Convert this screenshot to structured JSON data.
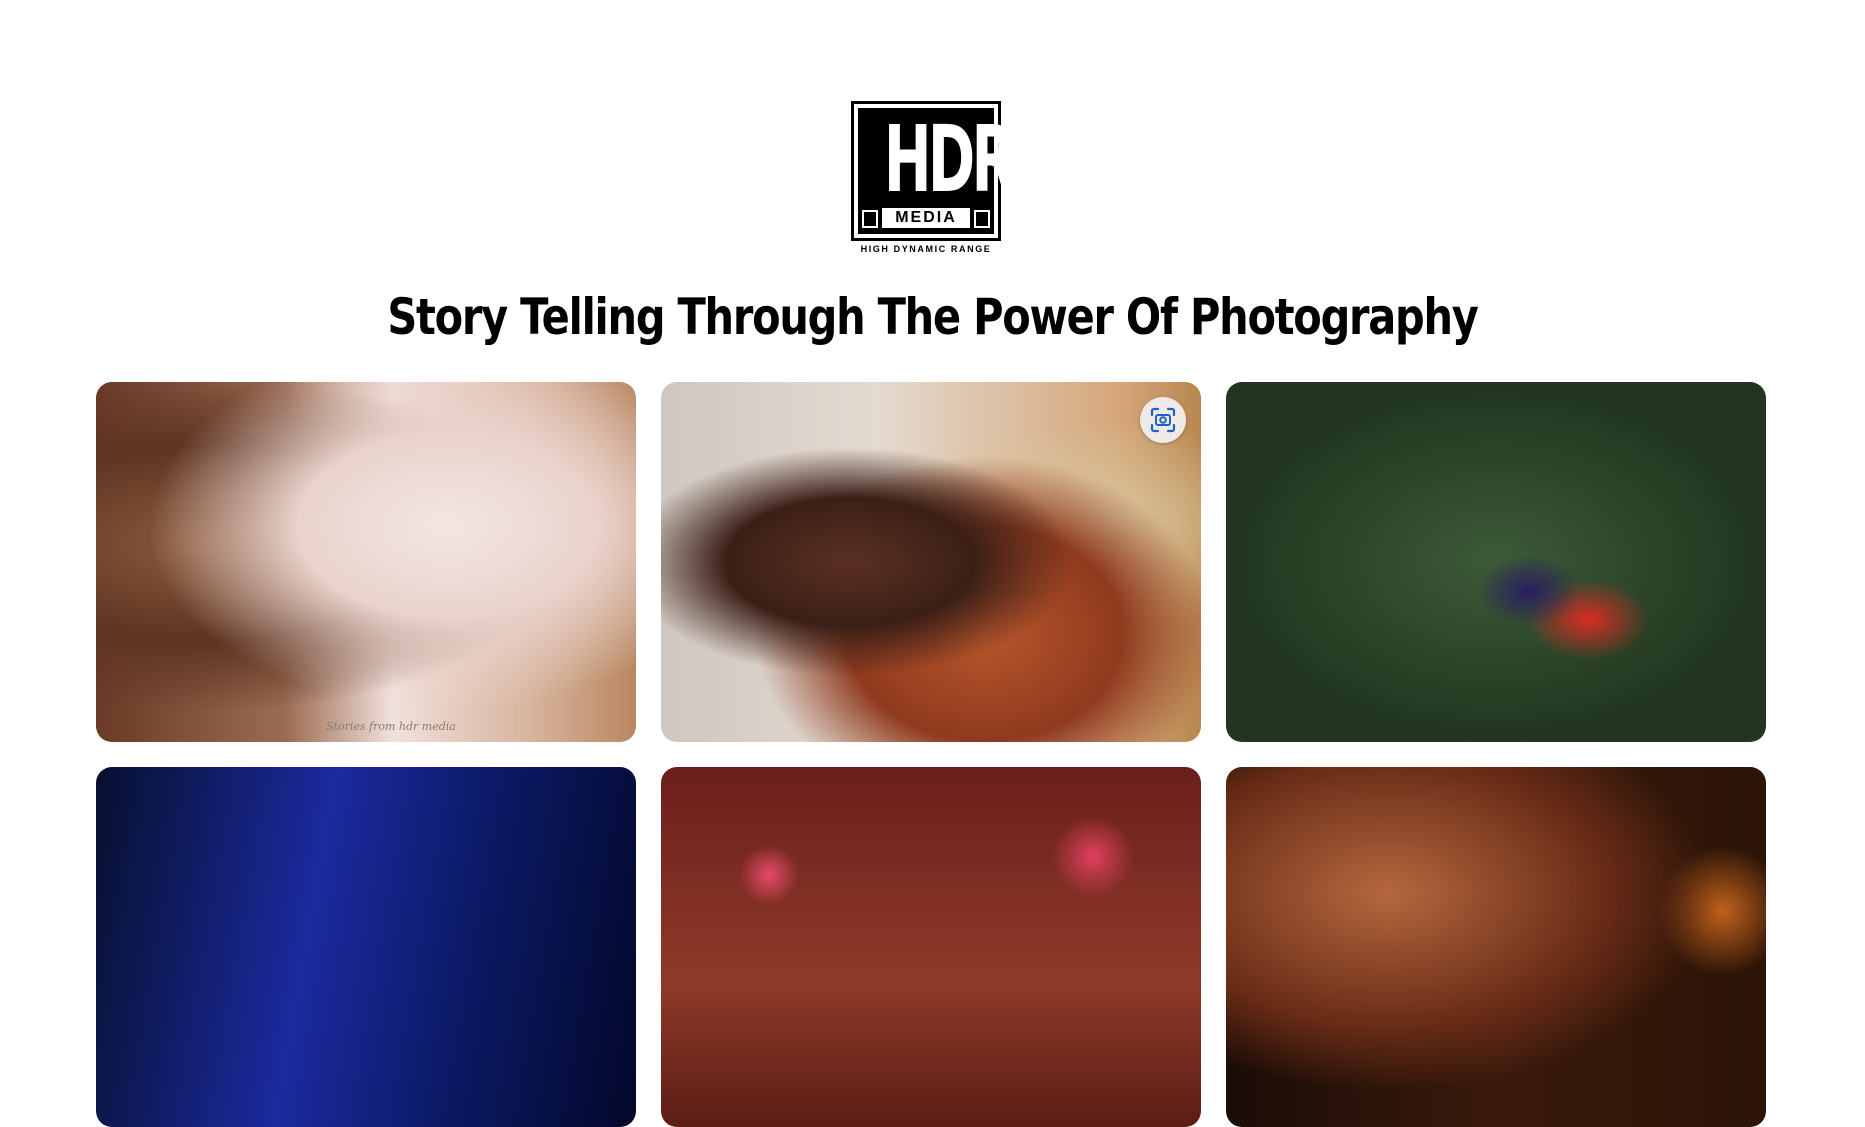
{
  "brand": {
    "logo_letters": "HDR",
    "logo_word": "MEDIA",
    "tagline": "HIGH DYNAMIC RANGE"
  },
  "headline": "Story Telling Through The Power Of Photography",
  "gallery": {
    "photos": [
      {
        "watermark": "Stories from hdr media"
      },
      {},
      {},
      {},
      {},
      {}
    ]
  },
  "icons": {
    "visual_search": "visual-search-icon"
  },
  "colors": {
    "background": "#ffffff",
    "text": "#000000",
    "scan_icon": "#1a64c8"
  }
}
